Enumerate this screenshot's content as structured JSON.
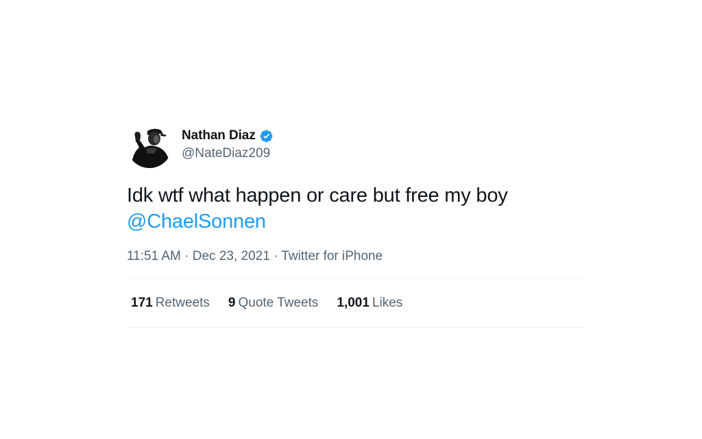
{
  "author": {
    "display_name": "Nathan Diaz",
    "handle": "@NateDiaz209",
    "verified": true
  },
  "tweet": {
    "text_line1": "Idk wtf what happen or care but free my boy",
    "mention": "@ChaelSonnen",
    "time": "11:51 AM",
    "separator1": " · ",
    "date": "Dec 23, 2021",
    "separator2": " · ",
    "source": "Twitter for iPhone"
  },
  "stats": {
    "retweets_count": "171",
    "retweets_label": "Retweets",
    "quotes_count": "9",
    "quotes_label": "Quote Tweets",
    "likes_count": "1,001",
    "likes_label": "Likes"
  },
  "colors": {
    "accent": "#1d9bf0",
    "text_primary": "#0f1419",
    "text_secondary": "#536471",
    "divider": "#eff3f4"
  },
  "icons": {
    "verified": "verified-badge-icon",
    "avatar": "profile-photo"
  }
}
